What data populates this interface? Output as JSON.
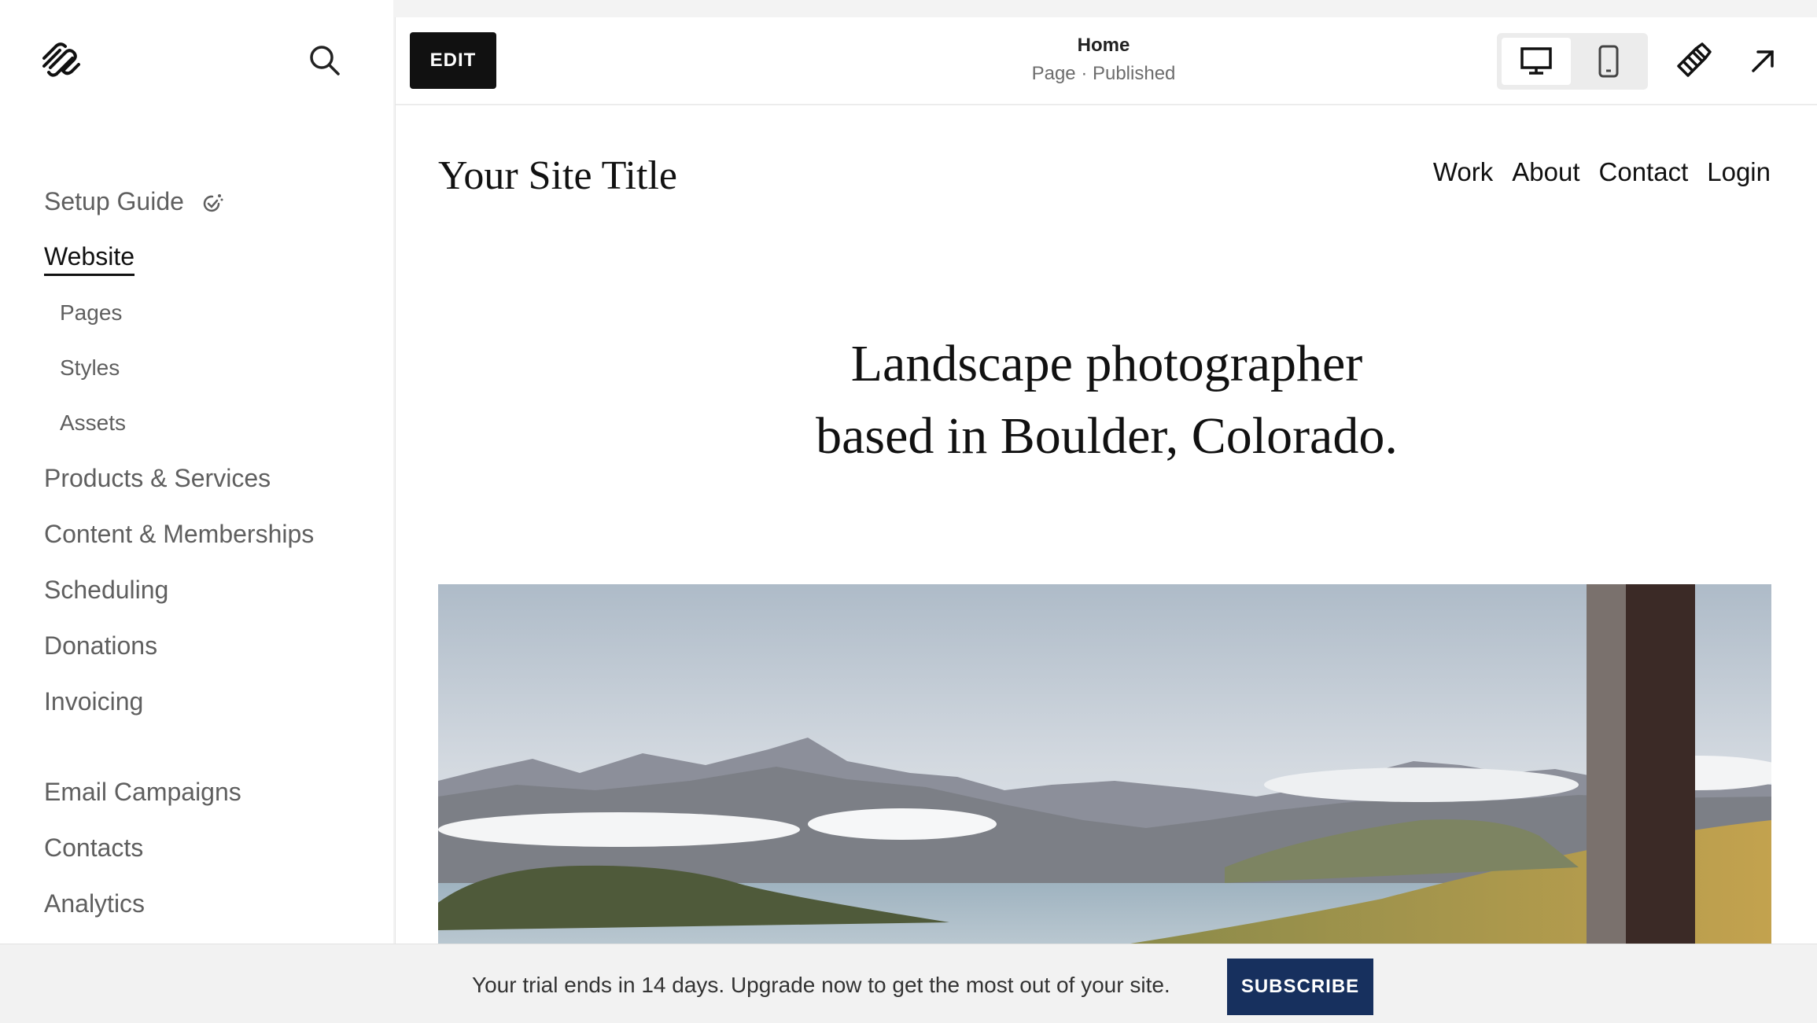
{
  "sidebar": {
    "logo_icon": "squarespace-logo-icon",
    "search_icon": "search-icon",
    "nav": {
      "setup_guide": "Setup Guide",
      "website": "Website",
      "pages": "Pages",
      "styles": "Styles",
      "assets": "Assets",
      "products_services": "Products & Services",
      "content_memberships": "Content & Memberships",
      "scheduling": "Scheduling",
      "donations": "Donations",
      "invoicing": "Invoicing",
      "email_campaigns": "Email Campaigns",
      "contacts": "Contacts",
      "analytics": "Analytics"
    }
  },
  "topbar": {
    "edit_label": "EDIT",
    "page_name": "Home",
    "page_status": "Page · Published",
    "device_selected": "desktop"
  },
  "site": {
    "title": "Your Site Title",
    "nav": [
      "Work",
      "About",
      "Contact",
      "Login"
    ],
    "hero_line1": "Landscape photographer",
    "hero_line2": "based in Boulder, Colorado."
  },
  "banner": {
    "message": "Your trial ends in 14 days. Upgrade now to get the most out of your site.",
    "subscribe_label": "SUBSCRIBE"
  },
  "colors": {
    "subscribe_bg": "#17305e",
    "edit_bg": "#111111"
  }
}
